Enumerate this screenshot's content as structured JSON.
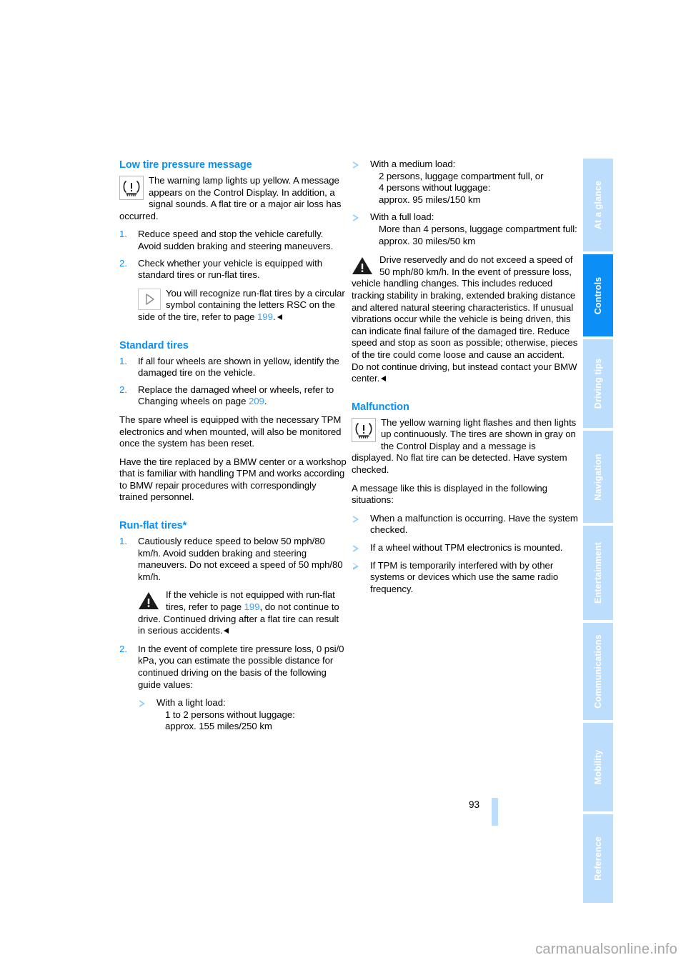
{
  "page": {
    "number": "93",
    "watermark": "carmanualsonline.info",
    "accent_blue": "#0a90f5",
    "tab_blue_light": "#bcddfb",
    "tab_blue_active": "#0b8ef5"
  },
  "tabs": [
    {
      "label": "At a glance",
      "active": false
    },
    {
      "label": "Controls",
      "active": true
    },
    {
      "label": "Driving tips",
      "active": false
    },
    {
      "label": "Navigation",
      "active": false
    },
    {
      "label": "Entertainment",
      "active": false
    },
    {
      "label": "Communications",
      "active": false
    },
    {
      "label": "Mobility",
      "active": false
    },
    {
      "label": "Reference",
      "active": false
    }
  ],
  "left_column": {
    "heading_low_pressure": "Low tire pressure message",
    "lamp_note": "The warning lamp lights up yellow. A message appears on the Control Display. In addition, a signal sounds. A flat tire or a major air loss has occurred.",
    "steps": [
      {
        "num": "1.",
        "text": "Reduce speed and stop the vehicle carefully. Avoid sudden braking and steering maneuvers."
      },
      {
        "num": "2.",
        "text": "Check whether your vehicle is equipped with standard tires or run-flat tires."
      }
    ],
    "rsc_note_pre": "You will recognize run-flat tires by a circular symbol containing the letters RSC on the side of the tire, refer to page ",
    "rsc_note_ref": "199",
    "rsc_note_post": ".",
    "heading_standard_tires": "Standard tires",
    "standard_steps": [
      {
        "num": "1.",
        "text": "If all four wheels are shown in yellow, identify the damaged tire on the vehicle."
      }
    ],
    "standard_step2_pre": "Replace the damaged wheel or wheels, refer to Changing wheels on page ",
    "standard_step2_num": "2.",
    "standard_step2_ref": "209",
    "standard_step2_post": ".",
    "spare_wheel_para": "The spare wheel is equipped with the necessary TPM electronics and when mounted, will also be monitored once the system has been reset.",
    "bmw_center_para": "Have the tire replaced by a BMW center or a workshop that is familiar with handling TPM and works according to BMW repair procedures with correspondingly trained personnel.",
    "heading_runflat": "Run-flat tires*",
    "runflat_step1_num": "1.",
    "runflat_step1_text": "Cautiously reduce speed to below 50 mph/80 km/h. Avoid sudden braking and steering maneuvers. Do not exceed a speed of 50 mph/80 km/h.",
    "runflat_warning_pre": "If the vehicle is not equipped with run-flat tires, refer to page ",
    "runflat_warning_ref": "199",
    "runflat_warning_post": ", do not continue to drive. Continued driving after a flat tire can result in serious accidents.",
    "runflat_step2_num": "2.",
    "runflat_step2_text": "In the event of complete tire pressure loss, 0 psi/0 kPa, you can estimate the possible distance for continued driving on the basis of the following guide values:",
    "load_light_line1": "With a light load:",
    "load_light_line2": "1 to 2 persons without luggage:",
    "load_light_line3": "approx. 155 miles/250 km"
  },
  "right_column": {
    "load_medium_line1": "With a medium load:",
    "load_medium_line2": "2 persons, luggage compartment full, or",
    "load_medium_line3": "4 persons without luggage:",
    "load_medium_line4": "approx. 95 miles/150 km",
    "load_full_line1": "With a full load:",
    "load_full_line2": "More than 4 persons, luggage compartment full:",
    "load_full_line3": "approx. 30 miles/50 km",
    "drive_reservedly_warning": "Drive reservedly and do not exceed a speed of 50 mph/80 km/h. In the event of pressure loss, vehicle handling changes. This includes reduced tracking stability in braking, extended braking distance and altered natural steering characteristics. If unusual vibrations occur while the vehicle is being driven, this can indicate final failure of the damaged tire. Reduce speed and stop as soon as possible; otherwise, pieces of the tire could come loose and cause an accident. Do not continue driving, but instead contact your BMW center.",
    "heading_malfunction": "Malfunction",
    "malfunction_note": "The yellow warning light flashes and then lights up continuously. The tires are shown in gray on the Control Display and a message is displayed. No flat tire can be detected. Have system checked.",
    "situations_intro": "A message like this is displayed in the following situations:",
    "situations": [
      "When a malfunction is occurring. Have the system checked.",
      "If a wheel without TPM electronics is mounted.",
      "If TPM is temporarily interfered with by other systems or devices which use the same radio frequency."
    ]
  },
  "icons": {
    "tpm_lamp": "tire-pressure-warning-lamp-icon",
    "caution_triangle": "caution-triangle-icon",
    "play_triangle": "note-triangle-icon"
  }
}
